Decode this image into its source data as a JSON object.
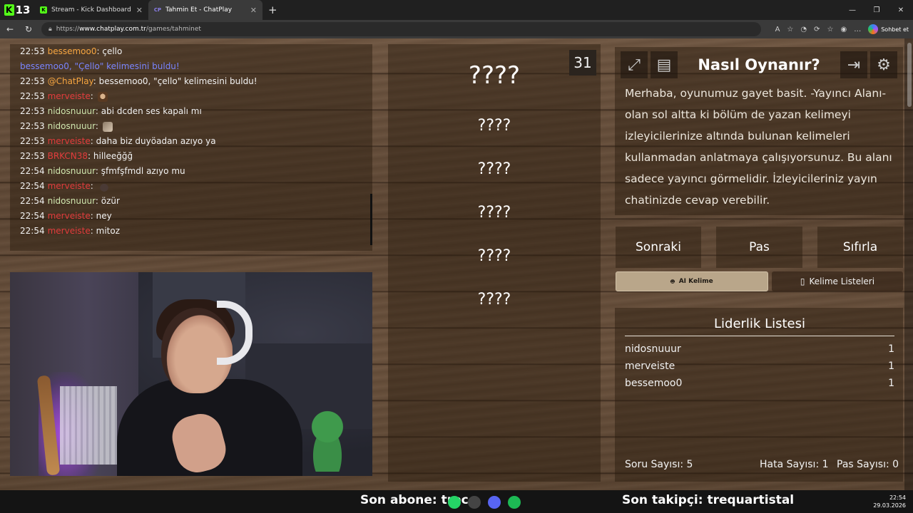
{
  "browser": {
    "badge_count": "13",
    "tabs": [
      {
        "favicon": "kick-icon",
        "title": "Stream - Kick Dashboard",
        "active": false
      },
      {
        "favicon": "chatplay-icon",
        "title": "Tahmin Et - ChatPlay",
        "active": true
      }
    ],
    "url_scheme": "https://",
    "url_host": "www.chatplay.com.tr",
    "url_path": "/games/tahminet",
    "sohbet_label": "Sohbet et"
  },
  "chat": {
    "messages": [
      {
        "time": "22:53",
        "user": "bessemoo0",
        "user_class": "u-bess",
        "text": "çello"
      },
      {
        "system": true,
        "text": "bessemoo0, \"Çello\" kelimesini buldu!"
      },
      {
        "time": "22:53",
        "user": "@ChatPlay",
        "user_class": "u-chat",
        "text": "bessemoo0, \"çello\" kelimesini buldu!"
      },
      {
        "time": "22:53",
        "user": "merveiste",
        "user_class": "u-merv",
        "text": "",
        "emote": "e1"
      },
      {
        "time": "22:53",
        "user": "nidosnuuur",
        "user_class": "u-nido",
        "text": "abi dcden ses kapalı mı"
      },
      {
        "time": "22:53",
        "user": "nidosnuuur",
        "user_class": "u-nido",
        "text": "",
        "emote": "e2"
      },
      {
        "time": "22:53",
        "user": "merveiste",
        "user_class": "u-merv",
        "text": "daha biz duyöadan azıyo ya"
      },
      {
        "time": "22:53",
        "user": "BRKCN38",
        "user_class": "u-brk",
        "text": "hilleeğğğ"
      },
      {
        "time": "22:54",
        "user": "nidosnuuur",
        "user_class": "u-nido",
        "text": "şfmfşfmdl azıyo mu"
      },
      {
        "time": "22:54",
        "user": "merveiste",
        "user_class": "u-merv",
        "text": "",
        "emote": "e3"
      },
      {
        "time": "22:54",
        "user": "nidosnuuur",
        "user_class": "u-nido",
        "text": "özür"
      },
      {
        "time": "22:54",
        "user": "merveiste",
        "user_class": "u-merv",
        "text": "ney"
      },
      {
        "time": "22:54",
        "user": "merveiste",
        "user_class": "u-merv",
        "text": "mitoz"
      }
    ]
  },
  "game": {
    "timer": "31",
    "main_word": "????",
    "forbidden_words": [
      "????",
      "????",
      "????",
      "????",
      "????"
    ]
  },
  "how_to": {
    "title": "Nasıl Oynanır?",
    "text": "Merhaba, oyunumuz gayet basit. -Yayıncı Alanı- olan sol altta ki bölüm de yazan kelimeyi izleyicilerinize altında bulunan kelimeleri kullanmadan anlatmaya çalışıyorsunuz. Bu alanı sadece yayıncı görmelidir. İzleyicileriniz yayın chatinizde cevap verebilir."
  },
  "controls": {
    "next": "Sonraki",
    "pass": "Pas",
    "reset": "Sıfırla",
    "ai_word": "AI Kelime",
    "word_lists": "Kelime Listeleri"
  },
  "leaderboard": {
    "title": "Liderlik Listesi",
    "rows": [
      {
        "name": "nidosnuuur",
        "score": "1"
      },
      {
        "name": "merveiste",
        "score": "1"
      },
      {
        "name": "bessemoo0",
        "score": "1"
      }
    ],
    "question_count": "Soru Sayısı: 5",
    "error_count": "Hata Sayısı: 1",
    "pass_count": "Pas Sayısı: 0"
  },
  "overlay": {
    "last_sub": "Son abone: trec",
    "last_follower": "Son takipçi: trequartistal",
    "time": "22:54",
    "date": "29.03.2026"
  }
}
